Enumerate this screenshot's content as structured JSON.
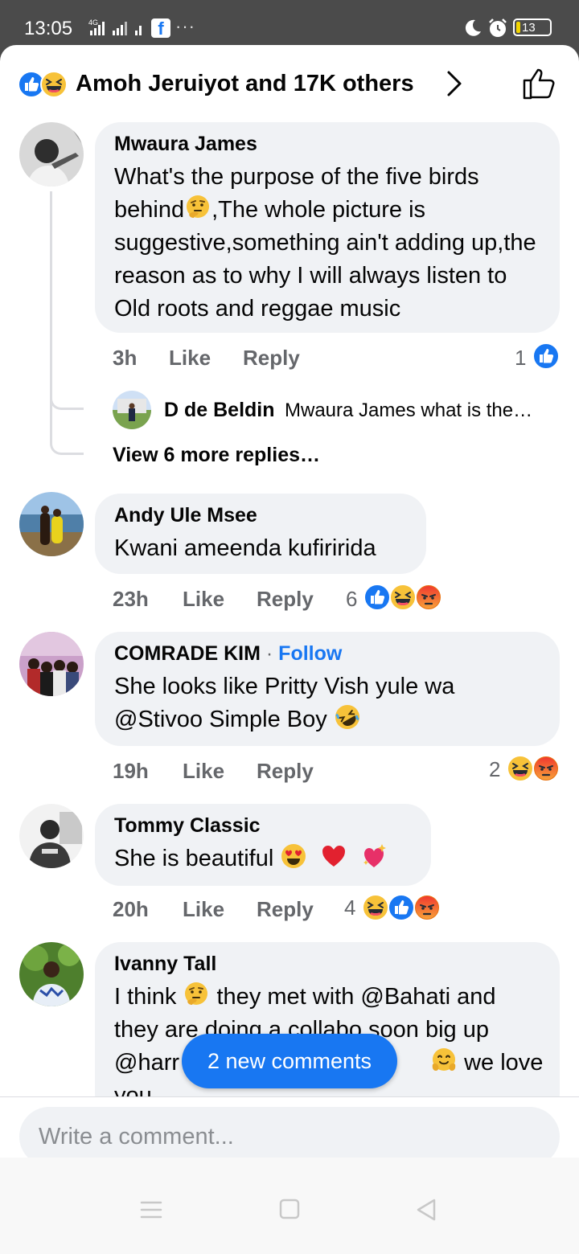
{
  "status_bar": {
    "time": "13:05",
    "network": "4G",
    "battery": "13"
  },
  "header": {
    "reaction_summary": "Amoh Jeruiyot and 17K others"
  },
  "comments": [
    {
      "author": "Mwaura James",
      "text": "What's the purpose of the five birds behind🤔,The whole picture is suggestive,something ain't adding up,the reason as to why I will always listen to Old roots and reggae music",
      "time": "3h",
      "like_label": "Like",
      "reply_label": "Reply",
      "reaction_count": "1",
      "reply_preview": {
        "author": "D de Beldin",
        "snippet": "Mwaura James what is the…"
      },
      "view_more": "View 6 more replies…"
    },
    {
      "author": "Andy Ule Msee",
      "text": "Kwani ameenda kufiririda",
      "time": "23h",
      "like_label": "Like",
      "reply_label": "Reply",
      "reaction_count": "6"
    },
    {
      "author": "COMRADE KIM",
      "follow": "Follow",
      "text": "She looks like Pritty Vish yule wa @Stivoo Simple Boy",
      "time": "19h",
      "like_label": "Like",
      "reply_label": "Reply",
      "reaction_count": "2"
    },
    {
      "author": "Tommy Classic",
      "text": "She is beautiful",
      "time": "20h",
      "like_label": "Like",
      "reply_label": "Reply",
      "reaction_count": "4"
    },
    {
      "author": "Ivanny Tall",
      "text_parts": [
        "I think",
        "they met with @Bahati and",
        "they are doing a collabo soon big up",
        "@harr",
        "we love",
        "you"
      ]
    }
  ],
  "new_comments_label": "2 new comments",
  "composer": {
    "placeholder": "Write a comment..."
  },
  "colors": {
    "accent": "#1877f2",
    "bubble": "#f0f2f5",
    "meta": "#65676b",
    "haha": "#f7c239",
    "angry": "#e9710f",
    "love": "#f33e58"
  },
  "icons": [
    "like-reaction-icon",
    "haha-reaction-icon",
    "angry-reaction-icon",
    "thinking-emoji-icon",
    "rofl-emoji-icon",
    "heart-eyes-emoji-icon",
    "red-heart-emoji-icon",
    "sparkling-heart-emoji-icon",
    "hug-emoji-icon",
    "chevron-right-icon",
    "thumbs-up-outline-icon"
  ]
}
